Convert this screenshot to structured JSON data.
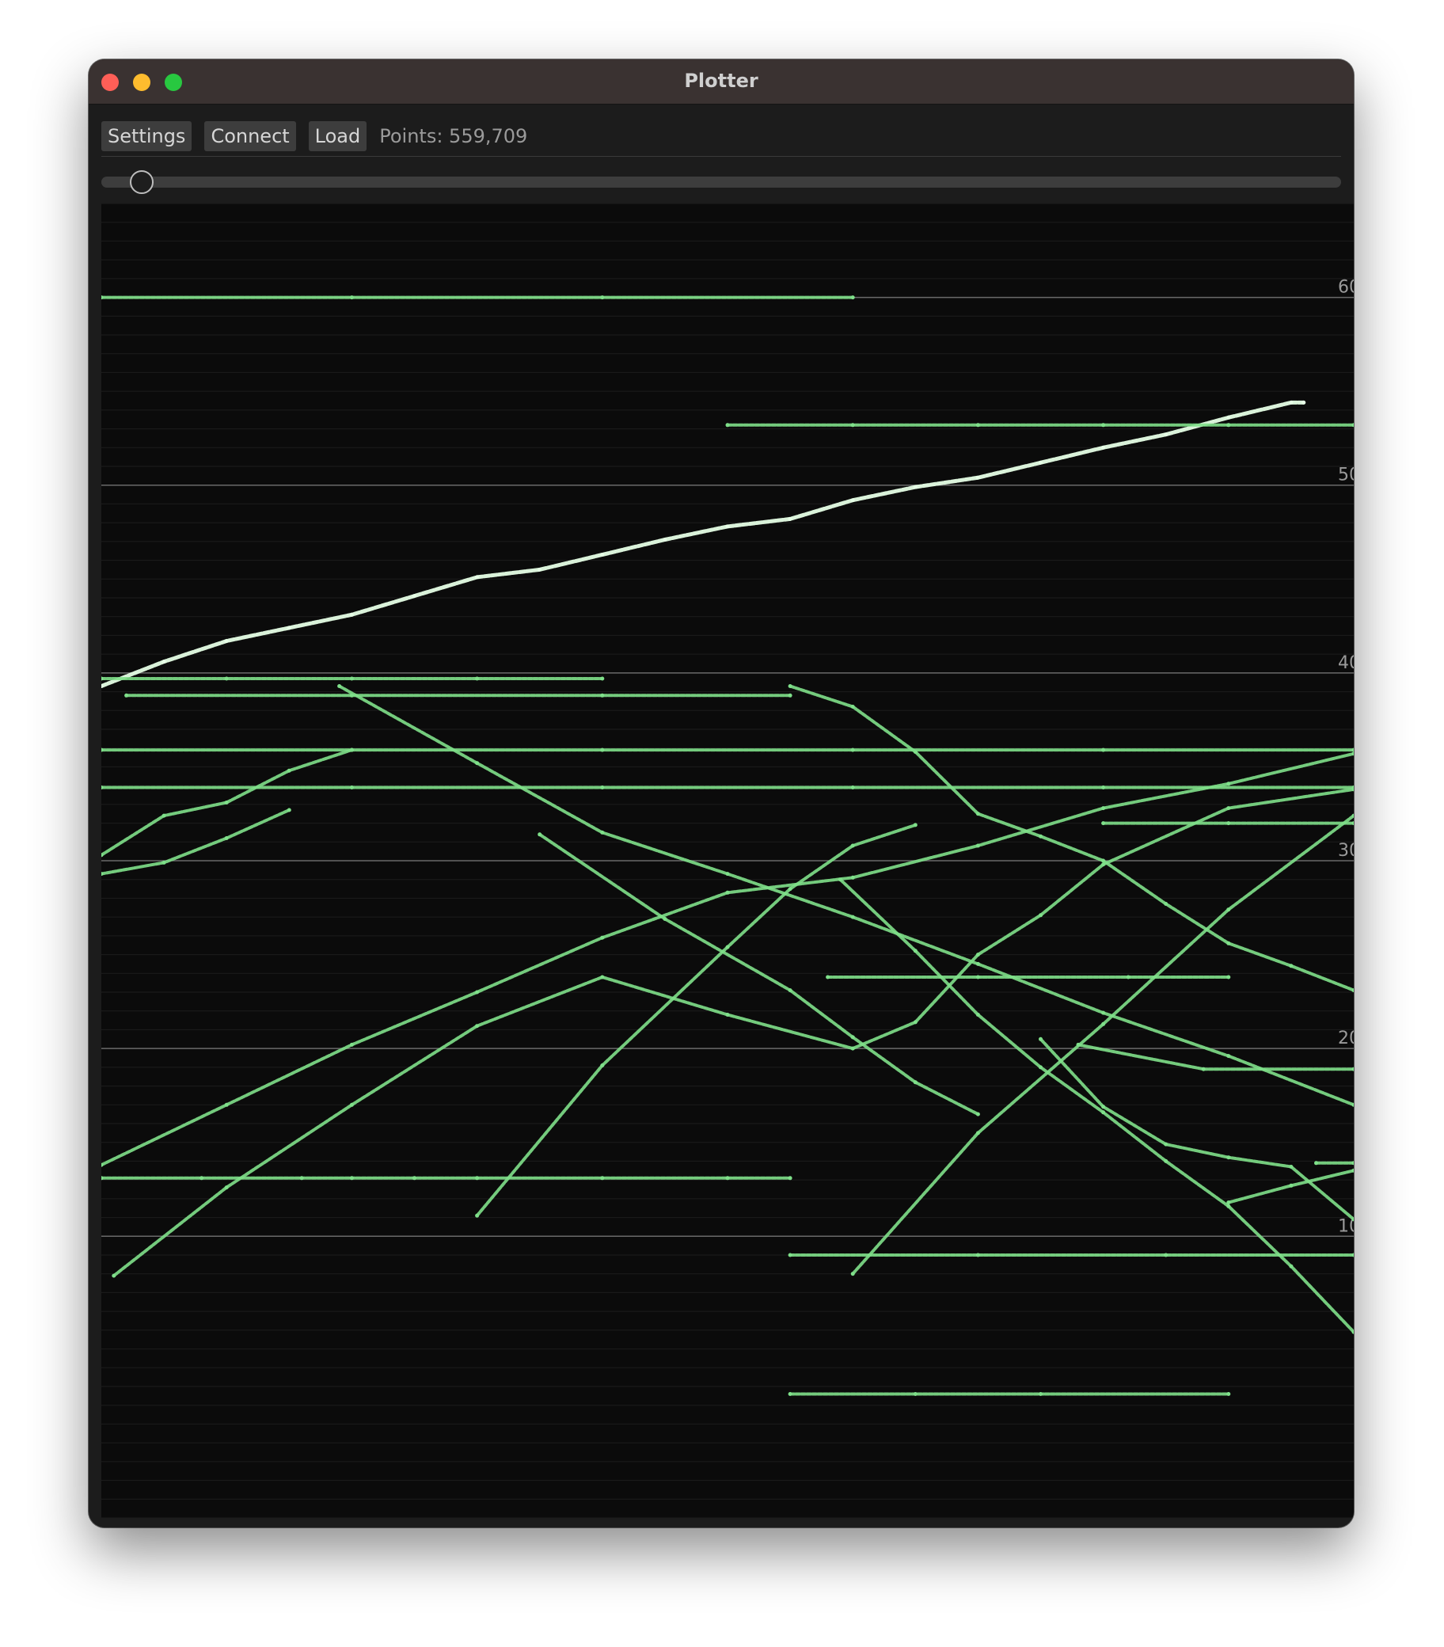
{
  "window": {
    "title": "Plotter"
  },
  "toolbar": {
    "settings_label": "Settings",
    "connect_label": "Connect",
    "load_label": "Load",
    "points_text": "Points: 559,709"
  },
  "colors": {
    "trace": "#7fe08a",
    "trace_bright": "#e6ffe6",
    "plot_bg": "#0b0b0b",
    "grid_major": "#6a6a6a",
    "grid_minor": "#1c1c1c"
  },
  "chart_data": {
    "type": "scatter",
    "title": "",
    "xlabel": "",
    "ylabel": "",
    "ylim": [
      -5,
      65
    ],
    "y_ticks": [
      "60",
      "50",
      "40",
      "30",
      "20",
      "10"
    ],
    "grid": true,
    "series": [
      {
        "x": [
          0,
          5,
          10,
          15,
          20,
          25,
          30,
          35,
          40,
          45,
          50,
          55,
          60,
          65,
          70,
          75,
          80,
          85,
          90,
          95,
          96
        ],
        "y": [
          39.3,
          40.6,
          41.7,
          42.4,
          43.1,
          44.1,
          45.1,
          45.5,
          46.3,
          47.1,
          47.8,
          48.2,
          49.2,
          49.9,
          50.4,
          51.2,
          52.0,
          52.7,
          53.6,
          54.4,
          54.4
        ]
      },
      {
        "x": [
          19,
          30,
          40,
          50,
          60,
          70,
          80,
          90,
          100
        ],
        "y": [
          39.3,
          35.2,
          31.5,
          29.3,
          27.0,
          24.5,
          21.9,
          19.6,
          17.0
        ]
      },
      {
        "x": [
          55,
          60,
          65,
          70,
          75,
          80,
          85,
          90,
          95,
          100
        ],
        "y": [
          39.3,
          38.2,
          35.8,
          32.5,
          31.3,
          30.0,
          27.7,
          25.6,
          24.4,
          23.1
        ]
      },
      {
        "x": [
          0,
          10,
          20,
          30,
          40,
          50,
          60,
          70,
          80,
          90,
          100
        ],
        "y": [
          13.8,
          17.0,
          20.2,
          23.0,
          25.9,
          28.3,
          29.1,
          30.8,
          32.8,
          34.1,
          35.7
        ]
      },
      {
        "x": [
          1,
          10,
          20,
          30,
          40,
          50,
          60,
          65,
          70,
          75,
          80,
          90,
          100
        ],
        "y": [
          7.9,
          12.6,
          17.0,
          21.2,
          23.8,
          21.8,
          20.0,
          21.4,
          25.0,
          27.1,
          29.8,
          32.8,
          33.8
        ]
      },
      {
        "x": [
          0,
          5,
          10,
          15,
          20
        ],
        "y": [
          30.3,
          32.4,
          33.1,
          34.8,
          35.9
        ]
      },
      {
        "x": [
          0,
          5,
          10,
          15
        ],
        "y": [
          29.3,
          29.9,
          31.2,
          32.7
        ]
      },
      {
        "x": [
          60,
          70,
          80,
          90,
          100
        ],
        "y": [
          8.0,
          15.5,
          21.3,
          27.4,
          32.4
        ]
      },
      {
        "x": [
          75,
          80,
          85,
          90,
          95,
          100
        ],
        "y": [
          20.5,
          16.9,
          14.9,
          14.2,
          13.7,
          10.9
        ]
      },
      {
        "x": [
          59,
          65,
          70,
          75,
          80,
          85,
          90,
          95,
          100
        ],
        "y": [
          29.0,
          25.2,
          21.8,
          19.0,
          16.6,
          14.0,
          11.6,
          8.4,
          4.9
        ]
      },
      {
        "x": [
          30,
          40,
          50,
          55,
          60,
          65
        ],
        "y": [
          11.1,
          19.1,
          25.4,
          28.5,
          30.8,
          31.9
        ]
      },
      {
        "x": [
          35,
          45,
          55,
          60,
          65,
          70
        ],
        "y": [
          31.4,
          26.9,
          23.1,
          20.6,
          18.2,
          16.5
        ]
      },
      {
        "x": [
          0,
          8,
          16,
          20,
          25,
          30,
          40,
          50,
          55
        ],
        "y": [
          13.1,
          13.1,
          13.1,
          13.1,
          13.1,
          13.1,
          13.1,
          13.1,
          13.1
        ]
      },
      {
        "x": [
          0,
          10,
          20,
          30,
          40
        ],
        "y": [
          39.7,
          39.7,
          39.7,
          39.7,
          39.7
        ]
      },
      {
        "x": [
          2,
          20,
          40,
          55
        ],
        "y": [
          38.8,
          38.8,
          38.8,
          38.8
        ]
      },
      {
        "x": [
          0,
          20,
          40,
          60,
          80,
          100
        ],
        "y": [
          35.9,
          35.9,
          35.9,
          35.9,
          35.9,
          35.9
        ]
      },
      {
        "x": [
          0,
          20,
          40,
          60,
          80,
          100
        ],
        "y": [
          33.9,
          33.9,
          33.9,
          33.9,
          33.9,
          33.9
        ]
      },
      {
        "x": [
          50,
          60,
          70,
          80,
          90,
          100
        ],
        "y": [
          53.2,
          53.2,
          53.2,
          53.2,
          53.2,
          53.2
        ]
      },
      {
        "x": [
          0,
          20,
          40,
          60
        ],
        "y": [
          60.0,
          60.0,
          60.0,
          60.0
        ]
      },
      {
        "x": [
          55,
          65,
          75,
          90
        ],
        "y": [
          1.6,
          1.6,
          1.6,
          1.6
        ]
      },
      {
        "x": [
          55,
          70,
          85,
          100
        ],
        "y": [
          9.0,
          9.0,
          9.0,
          9.0
        ]
      },
      {
        "x": [
          58,
          70,
          82,
          90
        ],
        "y": [
          23.8,
          23.8,
          23.8,
          23.8
        ]
      },
      {
        "x": [
          78,
          88,
          100
        ],
        "y": [
          20.2,
          18.9,
          18.9
        ]
      },
      {
        "x": [
          80,
          90,
          100
        ],
        "y": [
          32.0,
          32.0,
          32.0
        ]
      },
      {
        "x": [
          97,
          100
        ],
        "y": [
          13.9,
          13.9
        ]
      },
      {
        "x": [
          90,
          95,
          100
        ],
        "y": [
          11.8,
          12.7,
          13.5
        ]
      }
    ]
  }
}
